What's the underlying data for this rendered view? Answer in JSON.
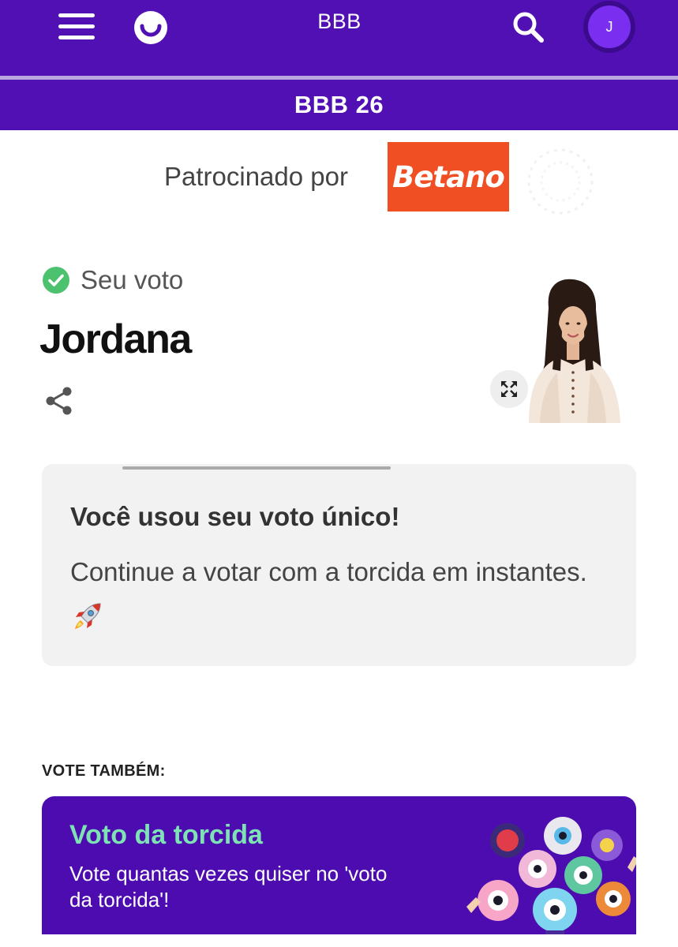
{
  "header": {
    "menu_icon": "hamburger-menu-icon",
    "logo_icon": "smile-logo-icon",
    "title": "BBB",
    "search_icon": "search-icon",
    "avatar_initial": "J"
  },
  "section": {
    "title": "BBB 26"
  },
  "sponsor": {
    "label": "Patrocinado por",
    "logo_text": "Betano",
    "logo_color": "#f04e23"
  },
  "vote": {
    "status_icon": "check-circle-icon",
    "status_label": "Seu voto",
    "candidate_name": "Jordana",
    "share_icon": "share-icon",
    "expand_icon": "expand-icon",
    "status_color": "#4cc26e"
  },
  "info_card": {
    "title": "Você usou seu voto único!",
    "body": "Continue a votar com a torcida em instantes.",
    "emoji_icon": "rocket-icon"
  },
  "vote_also": {
    "heading": "VOTE TAMBÉM:",
    "card": {
      "title": "Voto da torcida",
      "description": "Vote quantas vezes quiser no 'voto da torcida'!",
      "title_color": "#7ee2b4",
      "background": "#4d0cb0"
    }
  },
  "colors": {
    "brand_purple": "#5010b4",
    "avatar_purple": "#7a2ff0"
  }
}
